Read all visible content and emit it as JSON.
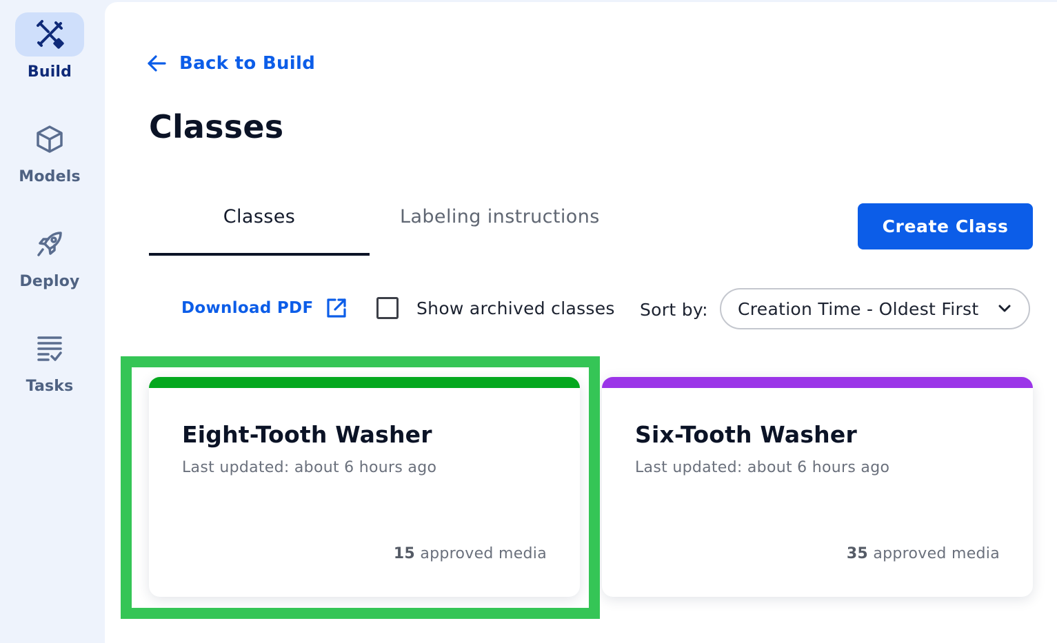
{
  "sidebar": {
    "items": [
      {
        "label": "Build",
        "icon": "tools-icon",
        "active": true
      },
      {
        "label": "Models",
        "icon": "cube-icon",
        "active": false
      },
      {
        "label": "Deploy",
        "icon": "rocket-icon",
        "active": false
      },
      {
        "label": "Tasks",
        "icon": "tasks-list-icon",
        "active": false
      }
    ]
  },
  "header": {
    "back_label": "Back to Build",
    "title": "Classes"
  },
  "tabs": [
    {
      "label": "Classes",
      "active": true
    },
    {
      "label": "Labeling instructions",
      "active": false
    }
  ],
  "actions": {
    "create_label": "Create Class"
  },
  "toolbar": {
    "download_label": "Download PDF",
    "archived_label": "Show archived classes",
    "archived_checked": false,
    "sort_label": "Sort by:",
    "sort_value": "Creation Time - Oldest First"
  },
  "classes": [
    {
      "name": "Eight-Tooth Washer",
      "updated": "Last updated: about 6 hours ago",
      "count": "15",
      "count_suffix": " approved media",
      "color": "#04a81e",
      "highlighted": true
    },
    {
      "name": "Six-Tooth Washer",
      "updated": "Last updated: about 6 hours ago",
      "count": "35",
      "count_suffix": " approved media",
      "color": "#9b35e8",
      "highlighted": false
    }
  ],
  "colors": {
    "accent": "#0c5de8",
    "highlight": "#35c556",
    "sidebar_bg": "#eef3fc"
  }
}
